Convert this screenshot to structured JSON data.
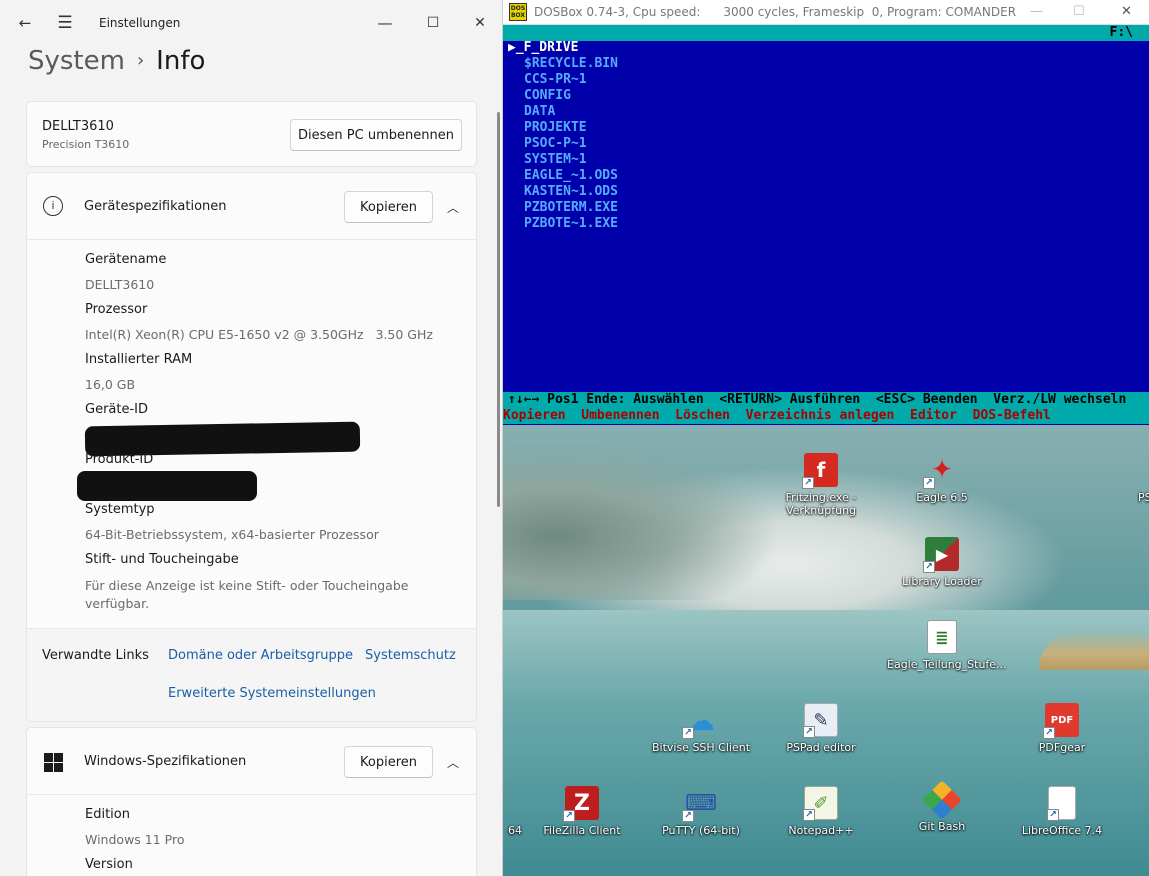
{
  "settings": {
    "app_title": "Einstellungen",
    "breadcrumb_parent": "System",
    "breadcrumb_separator": "›",
    "breadcrumb_current": "Info",
    "pc": {
      "name": "DELLT3610",
      "model": "Precision T3610",
      "rename_button": "Diesen PC umbenennen"
    },
    "device_specs": {
      "title": "Gerätespezifikationen",
      "copy_button": "Kopieren",
      "items": [
        {
          "label": "Gerätename",
          "value": "DELLT3610"
        },
        {
          "label": "Prozessor",
          "value": "Intel(R) Xeon(R) CPU E5-1650 v2 @ 3.50GHz   3.50 GHz"
        },
        {
          "label": "Installierter RAM",
          "value": "16,0 GB"
        },
        {
          "label": "Geräte-ID",
          "value": ""
        },
        {
          "label": "Produkt-ID",
          "value": ""
        },
        {
          "label": "Systemtyp",
          "value": "64-Bit-Betriebssystem, x64-basierter Prozessor"
        },
        {
          "label": "Stift- und Toucheingabe",
          "value": "Für diese Anzeige ist keine Stift- oder Toucheingabe",
          "value2": "verfügbar."
        }
      ]
    },
    "related_links": {
      "label": "Verwandte Links",
      "links": [
        "Domäne oder Arbeitsgruppe",
        "Systemschutz",
        "Erweiterte Systemeinstellungen"
      ]
    },
    "windows_specs": {
      "title": "Windows-Spezifikationen",
      "copy_button": "Kopieren",
      "items": [
        {
          "label": "Edition",
          "value": "Windows 11 Pro"
        },
        {
          "label": "Version",
          "value": ""
        }
      ]
    },
    "icons": {
      "back": "back-arrow-icon",
      "menu": "hamburger-menu-icon",
      "minimize": "minimize-icon",
      "maximize": "maximize-icon",
      "close": "close-icon",
      "info": "info-icon",
      "windows": "windows-logo-icon",
      "chevron": "chevron-up-icon"
    }
  },
  "dosbox": {
    "title": "DOSBox 0.74-3, Cpu speed:      3000 cycles, Frameskip  0, Program: COMANDER",
    "logo_text": "DOS BOX",
    "drive": "F:\\",
    "selected": "_F_DRIVE",
    "files": [
      "$RECYCLE.BIN",
      "CCS-PR~1",
      "CONFIG",
      "DATA",
      "PROJEKTE",
      "PSOC-P~1",
      "SYSTEM~1",
      "EAGLE_~1.ODS",
      "KASTEN~1.ODS",
      "PZBOTERM.EXE",
      "PZBOTE~1.EXE"
    ],
    "help_line1": "↑↓←→ Pos1 Ende: Auswählen  <RETURN> Ausführen  <ESC> Beenden  Verz./LW wechseln",
    "help_line2": "Kopieren  Umbenennen  Löschen  Verzeichnis anlegen  Editor  DOS-Befehl",
    "colors": {
      "background": "#0000aa",
      "bar": "#00aaaa",
      "file": "#55aaff",
      "selected": "#ffffff"
    }
  },
  "desktop": {
    "icons": [
      {
        "label": "Fritzing.exe -",
        "label2": "Verknüpfung",
        "icon": "fritzing-icon"
      },
      {
        "label": "Eagle 6.5",
        "label2": "",
        "icon": "eagle-icon"
      },
      {
        "label": "PS",
        "label2": "",
        "icon": "partial-icon"
      },
      {
        "label": "Library Loader",
        "label2": "",
        "icon": "library-loader-icon"
      },
      {
        "label": "Eagle_Teilung_Stufe...",
        "label2": "",
        "icon": "document-icon"
      },
      {
        "label": "Bitvise SSH Client",
        "label2": "",
        "icon": "bitvise-icon"
      },
      {
        "label": "PSPad editor",
        "label2": "",
        "icon": "pspad-icon"
      },
      {
        "label": "PDFgear",
        "label2": "",
        "icon": "pdfgear-icon"
      },
      {
        "label": "64",
        "label2": "",
        "icon": "partial-icon"
      },
      {
        "label": "FileZilla Client",
        "label2": "",
        "icon": "filezilla-icon"
      },
      {
        "label": "PuTTY (64-bit)",
        "label2": "",
        "icon": "putty-icon"
      },
      {
        "label": "Notepad++",
        "label2": "",
        "icon": "notepadpp-icon"
      },
      {
        "label": "Git Bash",
        "label2": "",
        "icon": "git-bash-icon"
      },
      {
        "label": "LibreOffice 7.4",
        "label2": "",
        "icon": "libreoffice-icon"
      }
    ]
  }
}
